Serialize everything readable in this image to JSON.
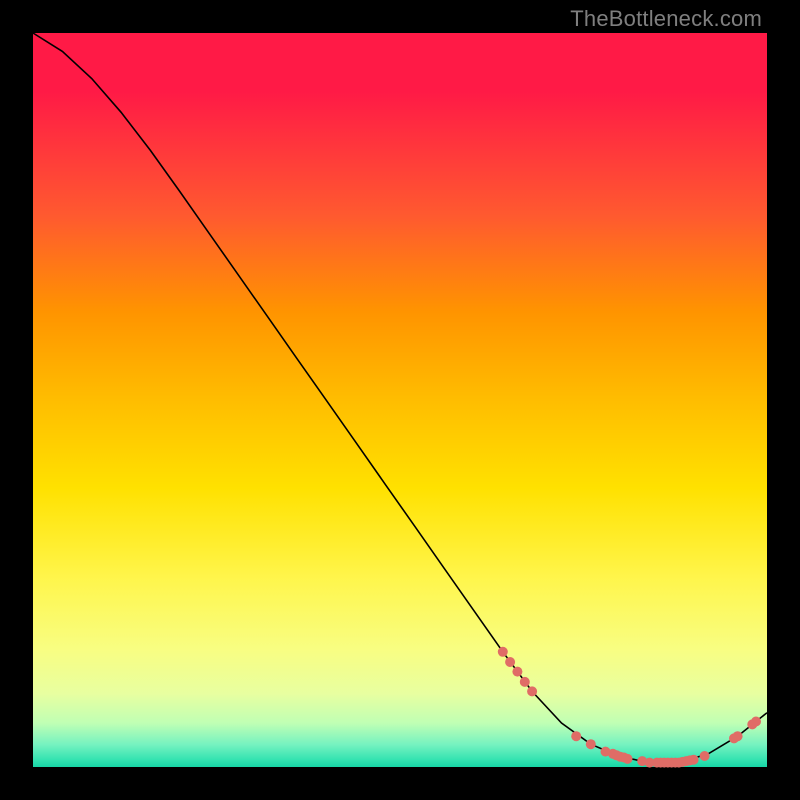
{
  "watermark": "TheBottleneck.com",
  "chart_data": {
    "type": "line",
    "title": "",
    "xlabel": "",
    "ylabel": "",
    "xlim": [
      0,
      100
    ],
    "ylim": [
      0,
      100
    ],
    "curve": {
      "x": [
        0,
        4,
        8,
        12,
        16,
        20,
        24,
        28,
        32,
        36,
        40,
        44,
        48,
        52,
        56,
        60,
        64,
        68,
        72,
        76,
        80,
        84,
        88,
        92,
        96,
        100
      ],
      "y": [
        100,
        97.5,
        93.8,
        89.2,
        84.0,
        78.4,
        72.7,
        67.0,
        61.3,
        55.6,
        49.9,
        44.2,
        38.5,
        32.8,
        27.1,
        21.4,
        15.7,
        10.3,
        6.0,
        3.1,
        1.4,
        0.6,
        0.6,
        1.8,
        4.2,
        7.4
      ]
    },
    "points": {
      "x": [
        64,
        65,
        66,
        67,
        68,
        74,
        76,
        78,
        79,
        79.5,
        80,
        80.5,
        81,
        83,
        84,
        85,
        85.5,
        86,
        86.5,
        87,
        87.5,
        88,
        88.5,
        89,
        89.5,
        90,
        91.5,
        95.5,
        96,
        98,
        98.5
      ],
      "y": [
        15.7,
        14.3,
        13.0,
        11.6,
        10.3,
        4.2,
        3.1,
        2.1,
        1.8,
        1.6,
        1.4,
        1.3,
        1.1,
        0.8,
        0.6,
        0.6,
        0.6,
        0.6,
        0.6,
        0.6,
        0.6,
        0.6,
        0.7,
        0.8,
        0.9,
        1.0,
        1.5,
        3.9,
        4.2,
        5.8,
        6.2
      ]
    },
    "colors": {
      "line": "#000000",
      "points": "#e06c66",
      "gradient_top": "#ff1a46",
      "gradient_mid": "#ffe100",
      "gradient_bottom": "#17d6a6"
    }
  }
}
